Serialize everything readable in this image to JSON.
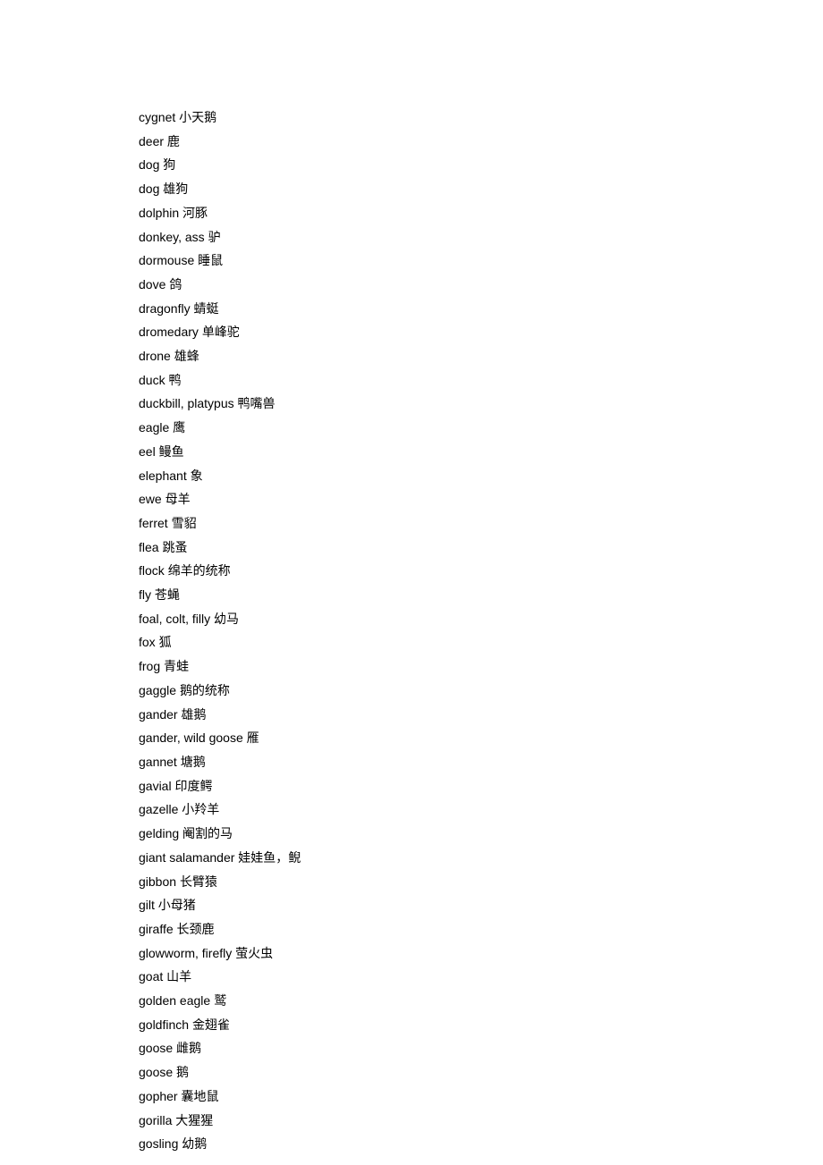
{
  "entries": [
    {
      "en": "cygnet",
      "zh": "小天鹅"
    },
    {
      "en": "deer",
      "zh": "鹿"
    },
    {
      "en": "dog",
      "zh": "狗"
    },
    {
      "en": "dog",
      "zh": "雄狗"
    },
    {
      "en": "dolphin ",
      "zh": "河豚"
    },
    {
      "en": "donkey, ass",
      "zh": "驴"
    },
    {
      "en": "dormouse",
      "zh": "睡鼠"
    },
    {
      "en": "dove",
      "zh": "鸽"
    },
    {
      "en": "dragonfly ",
      "zh": "蜻蜓"
    },
    {
      "en": "dromedary ",
      "zh": "单峰驼"
    },
    {
      "en": "drone",
      "zh": "雄蜂"
    },
    {
      "en": "duck",
      "zh": "鸭"
    },
    {
      "en": "duckbill, platypus  ",
      "zh": "鸭嘴兽"
    },
    {
      "en": "eagle",
      "zh": "鹰"
    },
    {
      "en": "eel",
      "zh": "鳗鱼"
    },
    {
      "en": "elephant",
      "zh": "象"
    },
    {
      "en": "ewe",
      "zh": "母羊"
    },
    {
      "en": "ferret ",
      "zh": "雪貂"
    },
    {
      "en": "flea",
      "zh": "跳蚤"
    },
    {
      "en": "flock ",
      "zh": "绵羊的统称"
    },
    {
      "en": "fly ",
      "zh": "苍蝇"
    },
    {
      "en": "foal, colt, filly   ",
      "zh": "幼马"
    },
    {
      "en": "fox ",
      "zh": "狐"
    },
    {
      "en": "frog ",
      "zh": "青蛙"
    },
    {
      "en": "gaggle",
      "zh": "鹅的统称"
    },
    {
      "en": "gander",
      "zh": "雄鹅"
    },
    {
      "en": "gander, wild goose",
      "zh": "雁"
    },
    {
      "en": "gannet",
      "zh": "塘鹅"
    },
    {
      "en": "gavial",
      "zh": "印度鳄"
    },
    {
      "en": "gazelle",
      "zh": "小羚羊"
    },
    {
      "en": "gelding ",
      "zh": "阉割的马"
    },
    {
      "en": "giant salamander",
      "zh": "娃娃鱼，鲵"
    },
    {
      "en": "gibbon",
      "zh": "长臂猿"
    },
    {
      "en": "gilt ",
      "zh": "小母猪"
    },
    {
      "en": "giraffe ",
      "zh": "长颈鹿"
    },
    {
      "en": "glowworm, firefly   ",
      "zh": "萤火虫"
    },
    {
      "en": "goat",
      "zh": "山羊"
    },
    {
      "en": "golden eagle",
      "zh": "鹫"
    },
    {
      "en": "goldfinch ",
      "zh": "金翅雀"
    },
    {
      "en": "goose",
      "zh": "雌鹅"
    },
    {
      "en": "goose",
      "zh": "鹅"
    },
    {
      "en": "gopher ",
      "zh": "囊地鼠"
    },
    {
      "en": "gorilla ",
      "zh": "大猩猩"
    },
    {
      "en": "gosling ",
      "zh": "幼鹅"
    }
  ]
}
